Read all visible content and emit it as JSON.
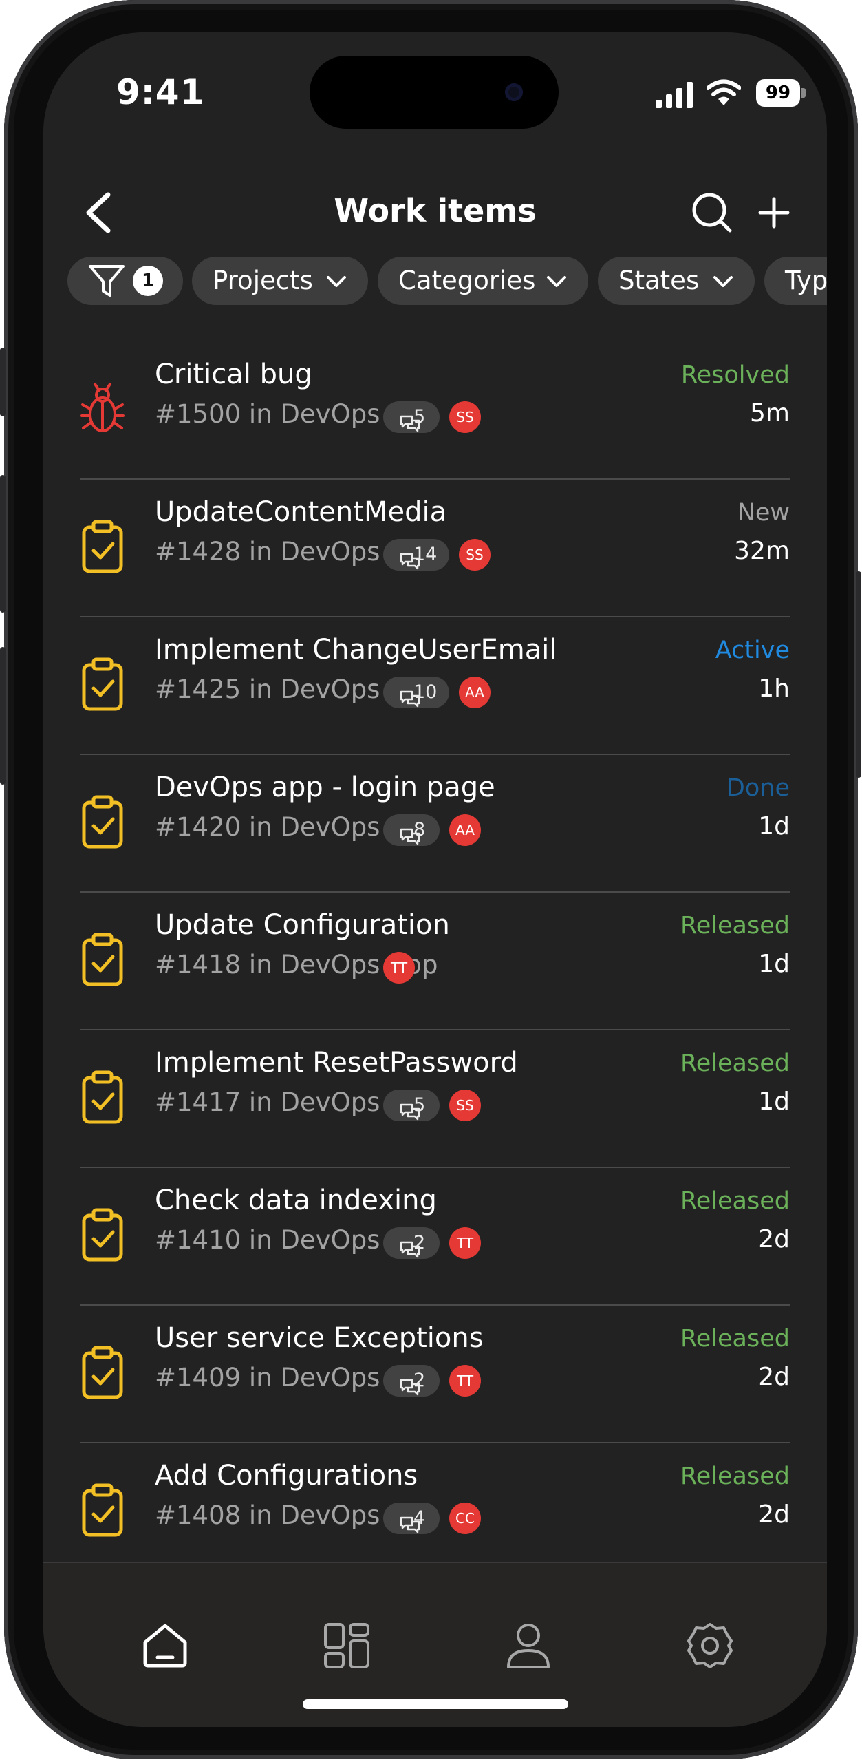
{
  "status_bar": {
    "time": "9:41",
    "battery": "99"
  },
  "header": {
    "title": "Work items"
  },
  "filters": {
    "filter_count": "1",
    "chips": [
      "Projects",
      "Categories",
      "States",
      "Type"
    ]
  },
  "colors": {
    "resolved": "#6bb15a",
    "new": "#a3a3a3",
    "active": "#1f8ae0",
    "done": "#1b5f99",
    "released": "#6bb15a",
    "avatar": "#e53935",
    "task_icon": "#f2c025",
    "bug_icon": "#e53935"
  },
  "items": [
    {
      "type_icon": "bug-icon",
      "title": "Critical bug",
      "ref": "#1500 in DevOps App",
      "comments": "5",
      "assignee": "SS",
      "state": "Resolved",
      "age": "5m"
    },
    {
      "type_icon": "clipboard-check-icon",
      "title": "UpdateContentMedia",
      "ref": "#1428 in DevOps App",
      "comments": "14",
      "assignee": "SS",
      "state": "New",
      "age": "32m"
    },
    {
      "type_icon": "clipboard-check-icon",
      "title": "Implement ChangeUserEmail",
      "ref": "#1425 in DevOps App",
      "comments": "10",
      "assignee": "AA",
      "state": "Active",
      "age": "1h"
    },
    {
      "type_icon": "clipboard-check-icon",
      "title": "DevOps app - login page",
      "ref": "#1420 in DevOps App",
      "comments": "8",
      "assignee": "AA",
      "state": "Done",
      "age": "1d"
    },
    {
      "type_icon": "clipboard-check-icon",
      "title": "Update Configuration",
      "ref": "#1418 in DevOps App",
      "comments": "",
      "assignee": "TT",
      "state": "Released",
      "age": "1d"
    },
    {
      "type_icon": "clipboard-check-icon",
      "title": "Implement ResetPassword",
      "ref": "#1417 in DevOps App",
      "comments": "5",
      "assignee": "SS",
      "state": "Released",
      "age": "1d"
    },
    {
      "type_icon": "clipboard-check-icon",
      "title": "Check data indexing",
      "ref": "#1410 in DevOps App",
      "comments": "2",
      "assignee": "TT",
      "state": "Released",
      "age": "2d"
    },
    {
      "type_icon": "clipboard-check-icon",
      "title": "User service Exceptions",
      "ref": "#1409 in DevOps App",
      "comments": "2",
      "assignee": "TT",
      "state": "Released",
      "age": "2d"
    },
    {
      "type_icon": "clipboard-check-icon",
      "title": "Add Configurations",
      "ref": "#1408 in DevOps App",
      "comments": "4",
      "assignee": "CC",
      "state": "Released",
      "age": "2d"
    }
  ],
  "tabbar": {
    "tabs": [
      {
        "icon": "home-icon"
      },
      {
        "icon": "dashboard-icon"
      },
      {
        "icon": "profile-icon"
      },
      {
        "icon": "settings-icon"
      }
    ]
  }
}
